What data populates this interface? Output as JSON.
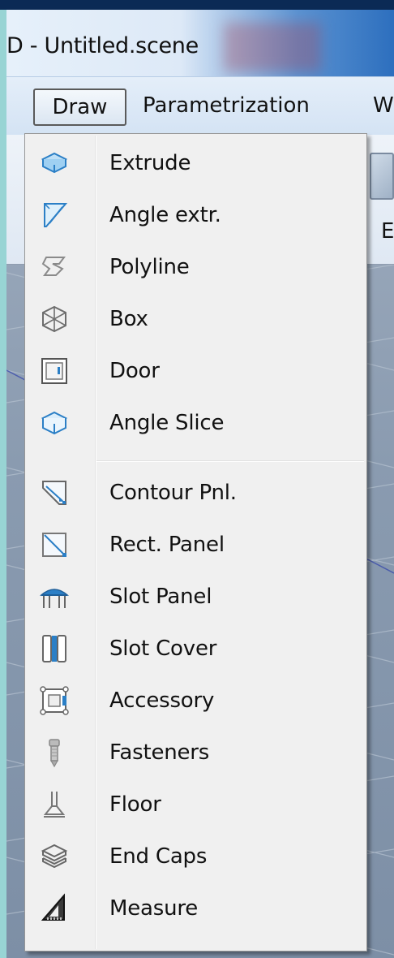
{
  "window": {
    "title": "D - Untitled.scene"
  },
  "menubar": {
    "items": [
      {
        "label": "Draw"
      },
      {
        "label": "Parametrization"
      },
      {
        "label": "W"
      }
    ]
  },
  "ribbon": {
    "partial_label": "E"
  },
  "draw_menu": {
    "items": [
      {
        "label": "Extrude",
        "icon": "extrude-icon"
      },
      {
        "label": "Angle extr.",
        "icon": "angle-extrude-icon"
      },
      {
        "label": "Polyline",
        "icon": "polyline-icon"
      },
      {
        "label": "Box",
        "icon": "box-icon"
      },
      {
        "label": "Door",
        "icon": "door-icon"
      },
      {
        "label": "Angle Slice",
        "icon": "angle-slice-icon"
      },
      {
        "label": "Contour Pnl.",
        "icon": "contour-panel-icon"
      },
      {
        "label": "Rect. Panel",
        "icon": "rect-panel-icon"
      },
      {
        "label": "Slot Panel",
        "icon": "slot-panel-icon"
      },
      {
        "label": "Slot Cover",
        "icon": "slot-cover-icon"
      },
      {
        "label": "Accessory",
        "icon": "accessory-icon"
      },
      {
        "label": "Fasteners",
        "icon": "fasteners-icon"
      },
      {
        "label": "Floor",
        "icon": "floor-icon"
      },
      {
        "label": "End Caps",
        "icon": "end-caps-icon"
      },
      {
        "label": "Measure",
        "icon": "measure-icon"
      }
    ]
  },
  "colors": {
    "menu_background": "#f0f0f0",
    "icon_blue": "#3a8fd6",
    "icon_gray": "#8a8a8a",
    "desktop": "#98d4d4"
  }
}
